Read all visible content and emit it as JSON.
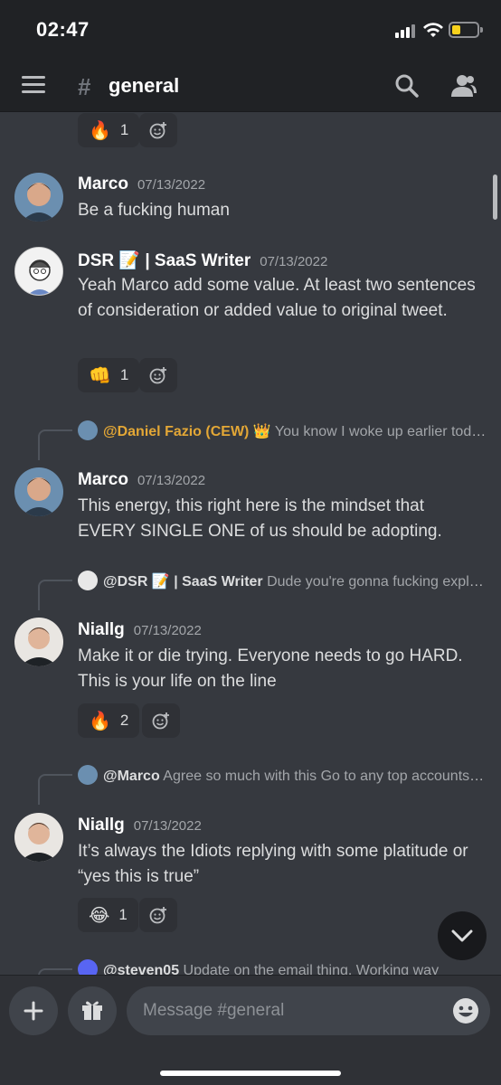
{
  "status_bar": {
    "time": "02:47"
  },
  "header": {
    "channel_name": "general"
  },
  "messages": [
    {
      "reaction": {
        "emoji": "🔥",
        "count": "1"
      }
    },
    {
      "author": "Marco",
      "timestamp": "07/13/2022",
      "text": "Be a fucking human"
    },
    {
      "author": "DSR 📝 | SaaS Writer",
      "timestamp": "07/13/2022",
      "text": "Yeah Marco add some value. At least two sentences of consideration or added value to original tweet.",
      "reaction": {
        "emoji": "👊",
        "count": "1"
      }
    },
    {
      "reply": {
        "mention": "@Daniel Fazio (CEW) 👑",
        "snippet": "You know I woke up earlier today and kinda was tired and said \"I will just film the …"
      },
      "author": "Marco",
      "timestamp": "07/13/2022",
      "text": "This energy, this right here is the mindset that EVERY SINGLE ONE of us should be adopting."
    },
    {
      "reply": {
        "mention": "@DSR 📝 | SaaS Writer",
        "snippet": "Dude you're gonna fucking explode Nial. Imma see you in one year and be like yup I…"
      },
      "author": "Niallg",
      "timestamp": "07/13/2022",
      "text": "Make it or die trying. Everyone needs to go HARD. This is your life on the line",
      "reaction": {
        "emoji": "🔥",
        "count": "2"
      }
    },
    {
      "reply": {
        "mention": "@Marco",
        "snippet": "Agree so much with this  Go to any top accounts post and you'll see about 80% of nerds just …"
      },
      "author": "Niallg",
      "timestamp": "07/13/2022",
      "text": "It’s always the Idiots replying with some platitude or “yes this is true”",
      "reaction": {
        "emoji": "😂",
        "count": "1"
      }
    },
    {
      "reply": {
        "mention": "@steven05",
        "snippet": "Update on the email thing.  Working way"
      }
    }
  ],
  "composer": {
    "placeholder": "Message #general"
  },
  "icons": {
    "menu": "menu-icon",
    "channel": "hash-icon",
    "search": "search-icon",
    "members": "members-icon",
    "add": "plus-icon",
    "gift": "gift-icon",
    "emoji": "emoji-icon",
    "add_reaction": "add-reaction-icon",
    "jump": "chevron-down-icon"
  },
  "colors": {
    "background": "#36393f",
    "header": "#202225",
    "mention_gold": "#e3a736",
    "battery": "#f8d21c"
  }
}
